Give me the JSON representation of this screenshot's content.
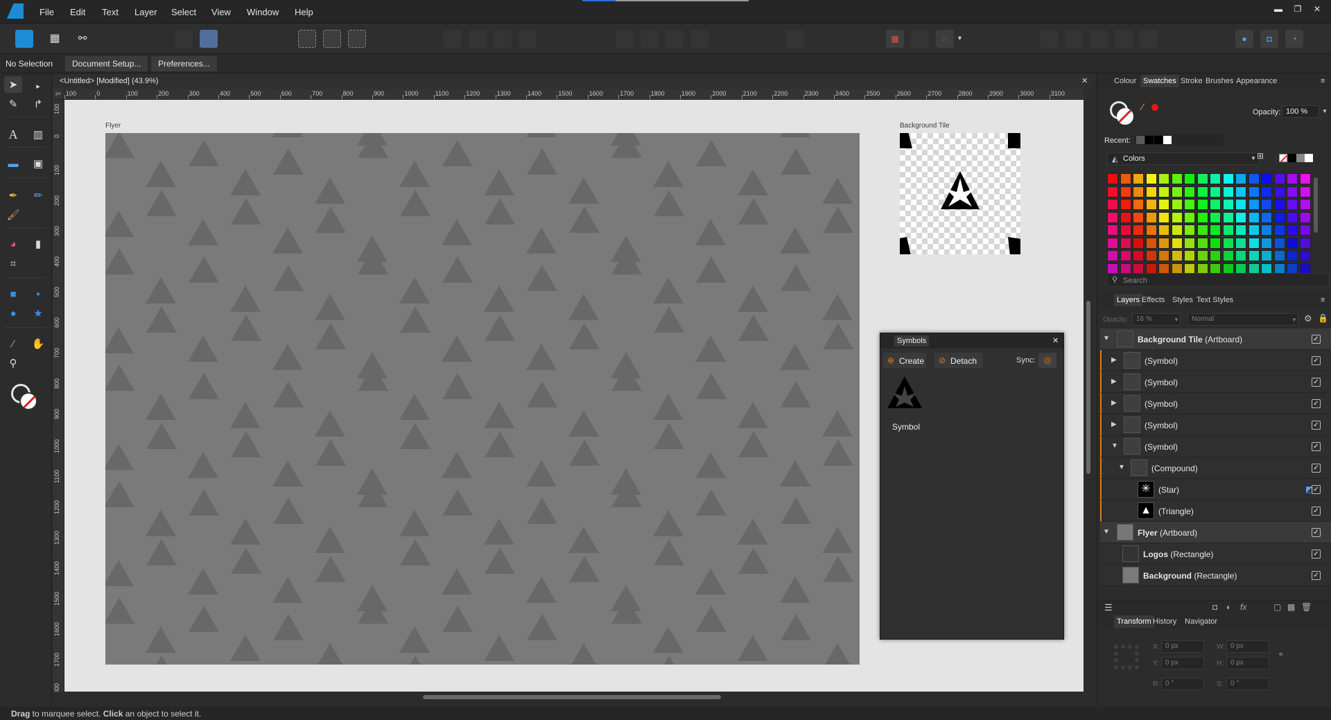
{
  "menu": {
    "items": [
      "File",
      "Edit",
      "Text",
      "Layer",
      "Select",
      "View",
      "Window",
      "Help"
    ]
  },
  "context_bar": {
    "selection": "No Selection",
    "document_setup": "Document Setup...",
    "preferences": "Preferences..."
  },
  "document": {
    "title": "<Untitled> [Modified] (43.9%)",
    "close": "✕"
  },
  "rulers": {
    "h_ticks": [
      "100",
      "0",
      "100",
      "200",
      "300",
      "400",
      "500",
      "600",
      "700",
      "800",
      "900",
      "1000",
      "1100",
      "1200",
      "1300",
      "1400",
      "1500",
      "1600",
      "1700",
      "1800",
      "1900",
      "2000",
      "2100",
      "2200",
      "2300",
      "2400",
      "2500",
      "2600",
      "2700",
      "2800",
      "2900",
      "3000",
      "3100"
    ],
    "v_ticks": [
      "100",
      "0",
      "100",
      "200",
      "300",
      "400",
      "500",
      "600",
      "700",
      "800",
      "900",
      "1000",
      "1100",
      "1200",
      "1300",
      "1400",
      "1500",
      "1600",
      "1700",
      "1800"
    ],
    "unit": "px"
  },
  "artboards": {
    "flyer_label": "Flyer",
    "tile_label": "Background Tile"
  },
  "symbols_panel": {
    "title": "Symbols",
    "create": "Create",
    "detach": "Detach",
    "sync": "Sync:",
    "symbol_name": "Symbol"
  },
  "swatches_panel": {
    "tabs": [
      "Colour",
      "Swatches",
      "Stroke",
      "Brushes",
      "Appearance"
    ],
    "active_tab": "Swatches",
    "opacity_label": "Opacity:",
    "opacity_value": "100 %",
    "recent_label": "Recent:",
    "palette_name": "Colors",
    "search_placeholder": "Search"
  },
  "layers_panel": {
    "tabs": [
      "Layers",
      "Effects",
      "Styles",
      "Text Styles"
    ],
    "active_tab": "Layers",
    "opacity_label": "Opacity:",
    "opacity_value": "16 %",
    "blend_mode": "Normal",
    "rows": [
      {
        "bold": "Background Tile",
        "rest": " (Artboard)"
      },
      {
        "bold": "",
        "rest": "(Symbol)"
      },
      {
        "bold": "",
        "rest": "(Symbol)"
      },
      {
        "bold": "",
        "rest": "(Symbol)"
      },
      {
        "bold": "",
        "rest": "(Symbol)"
      },
      {
        "bold": "",
        "rest": "(Symbol)"
      },
      {
        "bold": "",
        "rest": "(Compound)"
      },
      {
        "bold": "",
        "rest": "(Star)"
      },
      {
        "bold": "",
        "rest": "(Triangle)"
      },
      {
        "bold": "Flyer",
        "rest": " (Artboard)"
      },
      {
        "bold": "Logos",
        "rest": " (Rectangle)"
      },
      {
        "bold": "Background",
        "rest": " (Rectangle)"
      }
    ]
  },
  "transform_panel": {
    "tabs": [
      "Transform",
      "History",
      "Navigator"
    ],
    "active_tab": "Transform",
    "x_label": "X:",
    "x_value": "0 px",
    "y_label": "Y:",
    "y_value": "0 px",
    "w_label": "W:",
    "w_value": "0 px",
    "h_label": "H:",
    "h_value": "0 px",
    "r_label": "R:",
    "r_value": "0 °",
    "s_label": "S:",
    "s_value": "0 °"
  },
  "status": {
    "drag": "Drag",
    "text1": " to marquee select. ",
    "click": "Click",
    "text2": " an object to select it."
  },
  "colors": {
    "accent": "#1b8dd6",
    "selection_orange": "#e07b1a",
    "flyer_bg": "#7a7a7a",
    "pattern": "#686868"
  }
}
